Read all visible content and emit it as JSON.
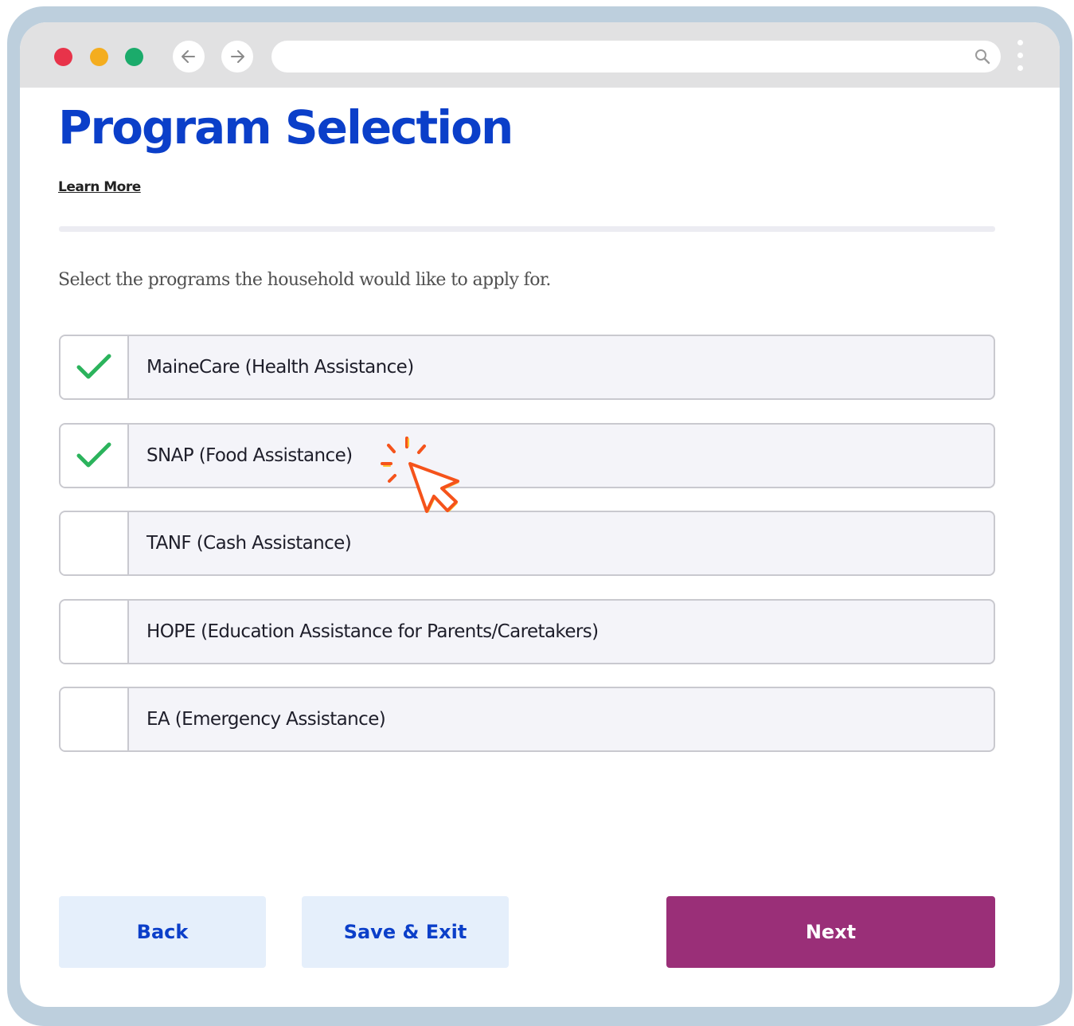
{
  "browser": {
    "traffic_light_colors": [
      "#e8334a",
      "#f4ad1f",
      "#1bab6b"
    ],
    "back_icon": "arrow-left-icon",
    "forward_icon": "arrow-right-icon",
    "search_icon": "search-icon",
    "menu_icon": "kebab-menu-icon",
    "url": ""
  },
  "page": {
    "title": "Program Selection",
    "learn_more": "Learn More",
    "instructions": "Select the programs the household would like to apply for."
  },
  "programs": [
    {
      "label": "MaineCare (Health Assistance)",
      "checked": true
    },
    {
      "label": "SNAP (Food Assistance)",
      "checked": true
    },
    {
      "label": "TANF (Cash Assistance)",
      "checked": false
    },
    {
      "label": "HOPE (Education Assistance for Parents/Caretakers)",
      "checked": false
    },
    {
      "label": "EA (Emergency Assistance)",
      "checked": false
    }
  ],
  "buttons": {
    "back": "Back",
    "save_exit": "Save & Exit",
    "next": "Next"
  },
  "colors": {
    "title": "#0b3fc9",
    "checkmark": "#2bb35c",
    "next_button": "#9a2f78",
    "secondary_button": "#e5effb",
    "cursor_accent": "#f5531b"
  }
}
